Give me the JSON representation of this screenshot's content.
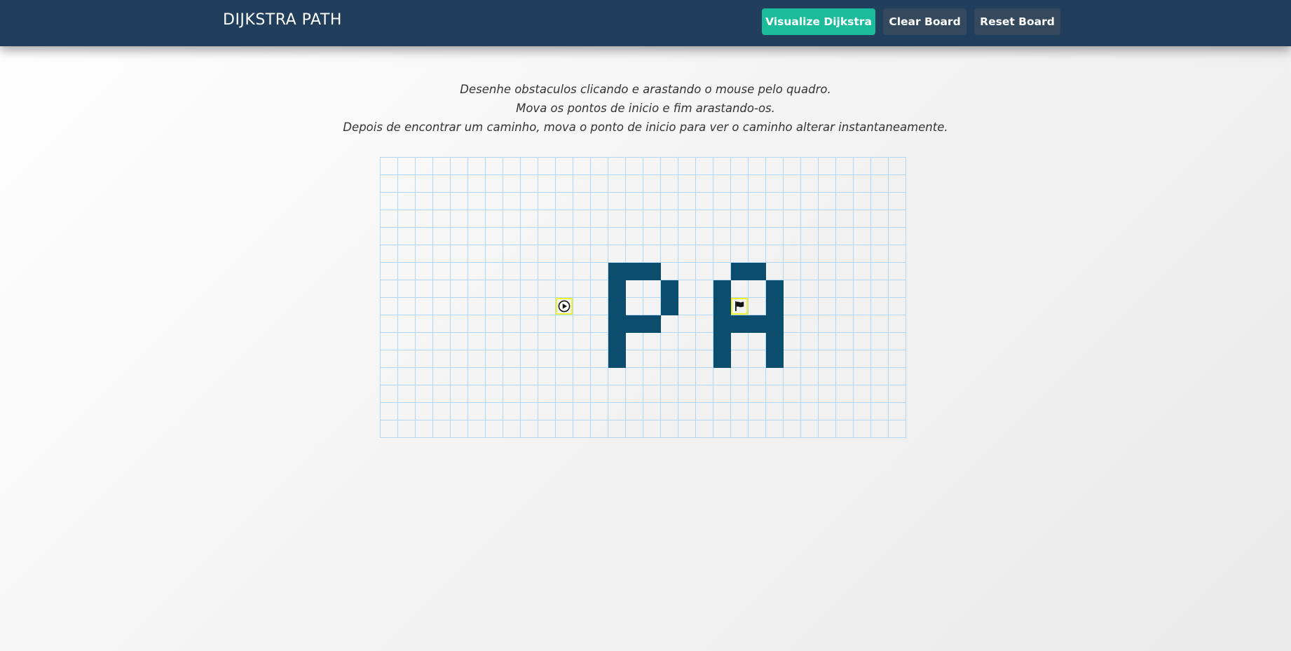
{
  "navbar": {
    "brand": "DIJKSTRA PATH",
    "buttons": {
      "visualize": "Visualize Dijkstra",
      "clear": "Clear Board",
      "reset": "Reset Board"
    }
  },
  "instructions": [
    "Desenhe obstaculos clicando e arastando o mouse pelo quadro.",
    "Mova os pontos de inicio e fim arastando-os.",
    "Depois de encontrar um caminho, mova o ponto de inicio para ver o caminho alterar instantaneamente."
  ],
  "grid": {
    "rows": 16,
    "cols": 30,
    "start": {
      "row": 8,
      "col": 10,
      "icon": "play-circle-icon"
    },
    "target": {
      "row": 8,
      "col": 20,
      "icon": "flag-icon"
    },
    "walls": [
      [
        6,
        13
      ],
      [
        6,
        14
      ],
      [
        6,
        15
      ],
      [
        7,
        13
      ],
      [
        7,
        16
      ],
      [
        8,
        13
      ],
      [
        8,
        16
      ],
      [
        9,
        13
      ],
      [
        9,
        14
      ],
      [
        9,
        15
      ],
      [
        10,
        13
      ],
      [
        11,
        13
      ],
      [
        6,
        20
      ],
      [
        6,
        21
      ],
      [
        7,
        19
      ],
      [
        7,
        22
      ],
      [
        8,
        19
      ],
      [
        8,
        22
      ],
      [
        9,
        19
      ],
      [
        9,
        20
      ],
      [
        9,
        21
      ],
      [
        9,
        22
      ],
      [
        10,
        19
      ],
      [
        10,
        22
      ],
      [
        11,
        19
      ],
      [
        11,
        22
      ]
    ]
  },
  "colors": {
    "navbar": "#213e5c",
    "accent": "#1abc9c",
    "secondary_button": "#35495e",
    "wall": "#0c4d6e",
    "grid_line": "#afd8f8",
    "node_highlight": "#f2f22d"
  }
}
